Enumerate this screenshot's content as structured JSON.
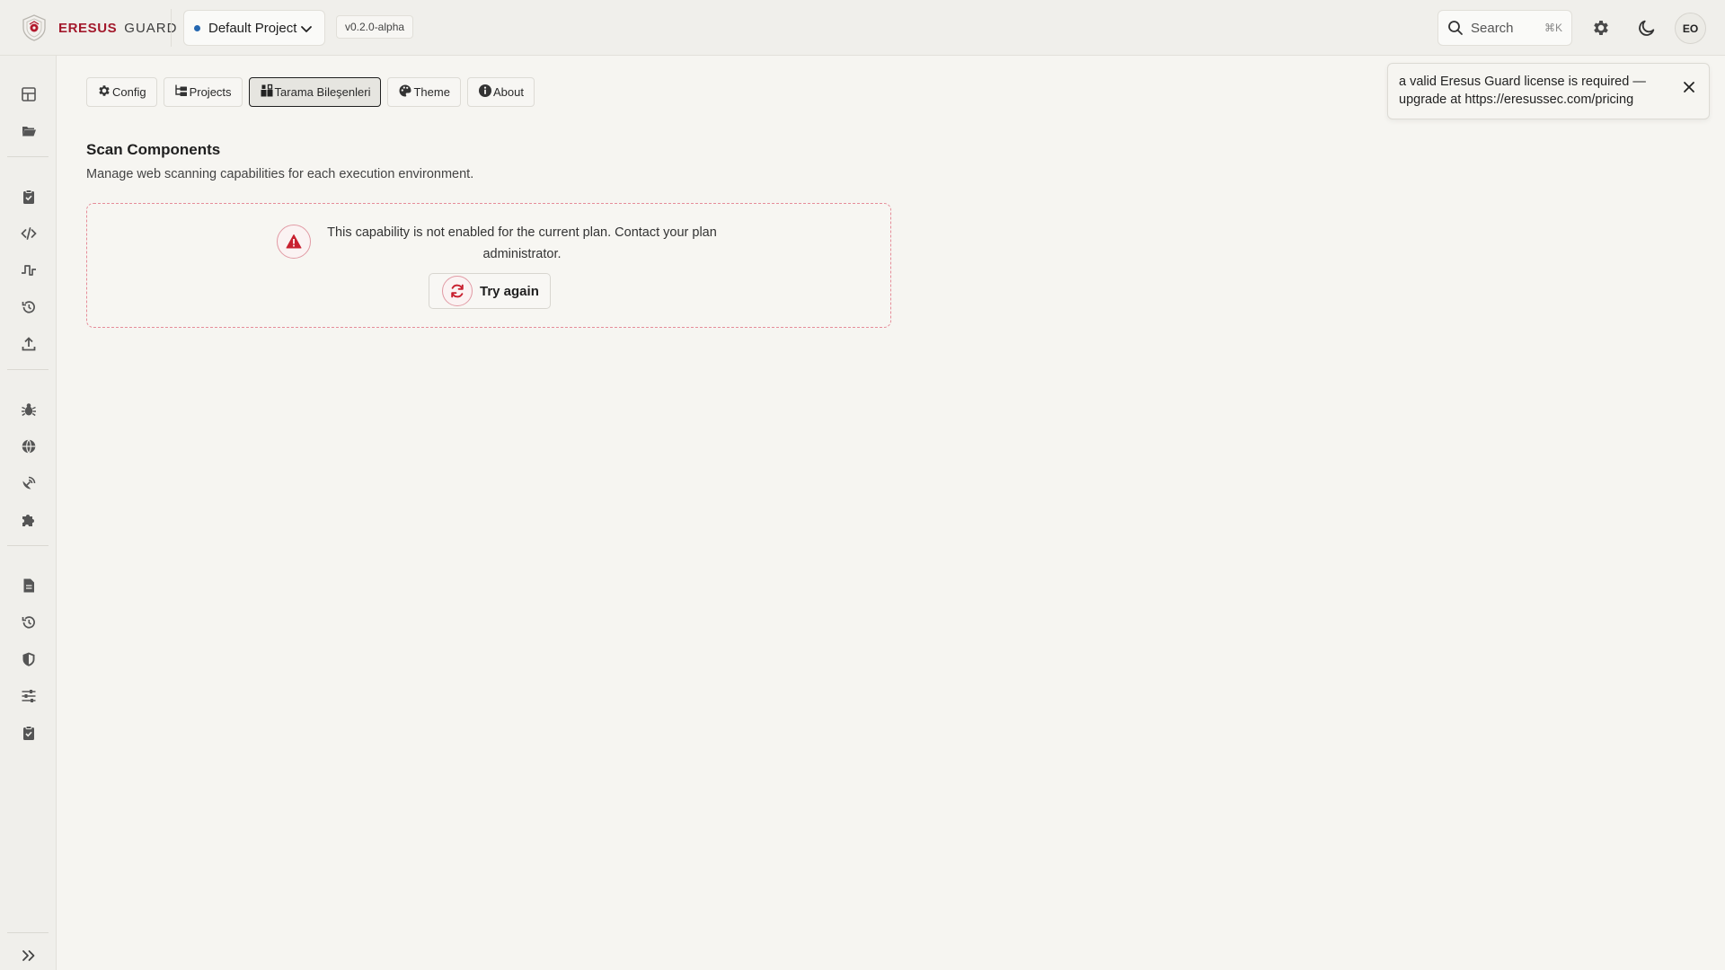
{
  "brand": {
    "primary": "ERESUS",
    "secondary": "GUARD",
    "logo_icon": "shield-logo-icon",
    "accent_color": "#a3192c"
  },
  "header": {
    "project": {
      "name": "Default Project",
      "status_color": "#2467b0"
    },
    "version": "v0.2.0-alpha",
    "search": {
      "placeholder": "Search",
      "shortcut": "⌘K"
    },
    "avatar_initials": "EO"
  },
  "tabs": [
    {
      "label": "Config",
      "icon": "gear-icon"
    },
    {
      "label": "Projects",
      "icon": "folder-tree-icon"
    },
    {
      "label": "Tarama Bileşenleri",
      "icon": "cubes-icon",
      "active": true
    },
    {
      "label": "Theme",
      "icon": "palette-icon"
    },
    {
      "label": "About",
      "icon": "info-icon"
    }
  ],
  "section": {
    "title": "Scan Components",
    "subtitle": "Manage web scanning capabilities for each execution environment."
  },
  "error": {
    "message": "This capability is not enabled for the current plan. Contact your plan administrator.",
    "retry_label": "Try again",
    "color": "#c8202f"
  },
  "toast": {
    "message": "a valid Eresus Guard license is required — upgrade at https://eresussec.com/pricing"
  },
  "sidebar_icons": [
    "dashboard-icon",
    "folder-open-icon",
    "clipboard-check-icon",
    "code-icon",
    "waveform-icon",
    "history-icon",
    "upload-icon",
    "bug-icon",
    "globe-icon",
    "satellite-dish-icon",
    "puzzle-icon",
    "file-icon",
    "history-icon",
    "shield-icon",
    "sliders-icon",
    "clipboard-check-icon",
    "expand-icon"
  ]
}
